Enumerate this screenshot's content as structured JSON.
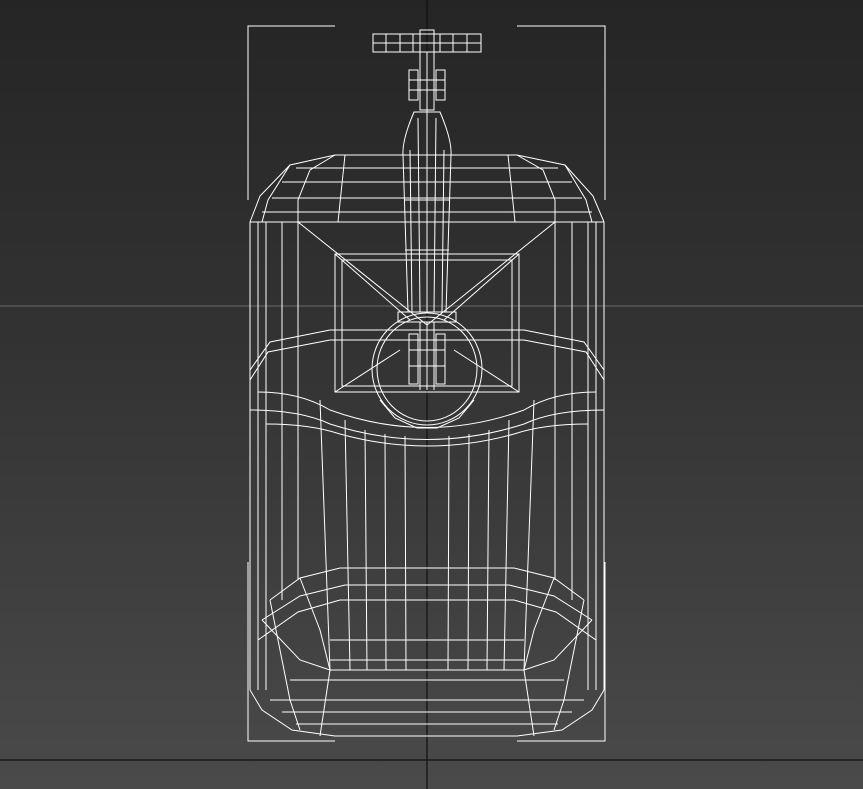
{
  "viewport": {
    "view": "wireframe-front",
    "background_top": "#252525",
    "background_bottom": "#4a4a4a",
    "wire_color": "#ffffff",
    "grid_axis_color": "#111111",
    "grid_line_color": "#6a6a6a",
    "object": "lantern-wireframe-model",
    "selection_bracket_color": "#ffffff"
  }
}
